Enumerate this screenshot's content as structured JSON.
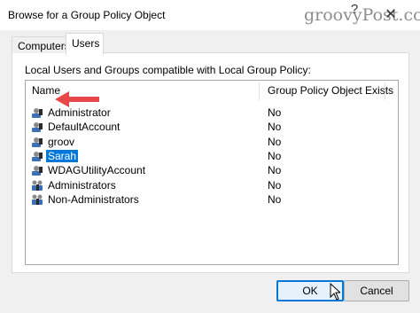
{
  "window": {
    "title": "Browse for a Group Policy Object",
    "watermark": "groovyPost.com",
    "help_glyph": "?",
    "close_glyph": "✕"
  },
  "tabs": [
    {
      "label": "Computers",
      "active": false
    },
    {
      "label": "Users",
      "active": true
    }
  ],
  "panel": {
    "caption": "Local Users and Groups compatible with Local Group Policy:",
    "columns": [
      "Name",
      "Group Policy Object Exists"
    ],
    "rows": [
      {
        "name": "Administrator",
        "exists": "No",
        "icon": "user-icon"
      },
      {
        "name": "DefaultAccount",
        "exists": "No",
        "icon": "user-icon"
      },
      {
        "name": "groov",
        "exists": "No",
        "icon": "user-icon"
      },
      {
        "name": "Sarah",
        "exists": "No",
        "icon": "user-icon",
        "selected": true
      },
      {
        "name": "WDAGUtilityAccount",
        "exists": "No",
        "icon": "user-icon"
      },
      {
        "name": "Administrators",
        "exists": "No",
        "icon": "group-icon"
      },
      {
        "name": "Non-Administrators",
        "exists": "No",
        "icon": "group-icon"
      }
    ]
  },
  "buttons": {
    "ok": "OK",
    "cancel": "Cancel"
  },
  "colors": {
    "selection": "#0078d7",
    "annotation_arrow": "#e8474a"
  }
}
